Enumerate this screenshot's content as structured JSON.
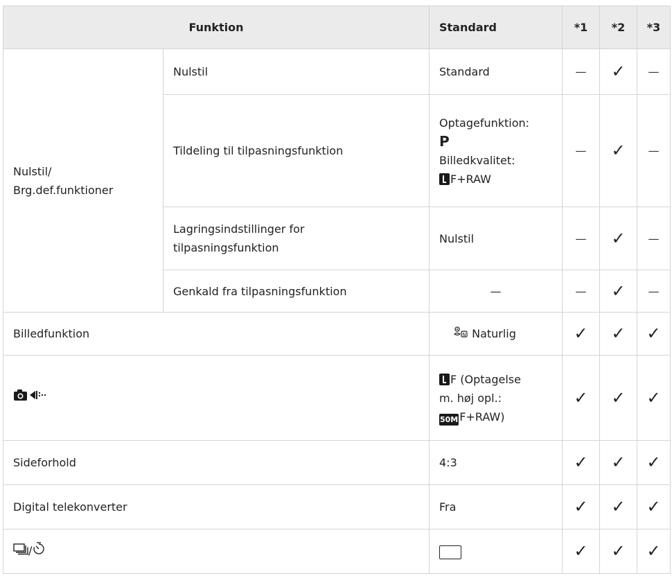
{
  "header": {
    "function": "Funktion",
    "standard": "Standard",
    "col1": "*1",
    "col2": "*2",
    "col3": "*3"
  },
  "symbols": {
    "check": "✓",
    "dash": "—"
  },
  "group": {
    "label_line1": "Nulstil/",
    "label_line2": "Brg.def.funktioner",
    "rows": [
      {
        "name": "Nulstil",
        "standard": "Standard",
        "c1": "—",
        "c2": "✓",
        "c3": "—"
      },
      {
        "name": "Tildeling til tilpasningsfunktion",
        "standard_line1": "Optagefunktion:",
        "standard_mode": "P",
        "standard_line3": "Billedkvalitet:",
        "standard_quality": "F+RAW",
        "standard_quality_icon": "large-fine-icon",
        "c1": "—",
        "c2": "✓",
        "c3": "—"
      },
      {
        "name_line1": "Lagringsindstillinger for",
        "name_line2": "tilpasningsfunktion",
        "standard": "Nulstil",
        "c1": "—",
        "c2": "✓",
        "c3": "—"
      },
      {
        "name": "Genkald fra tilpasningsfunktion",
        "standard": "—",
        "c1": "—",
        "c2": "✓",
        "c3": "—"
      }
    ]
  },
  "rows": [
    {
      "name": "Billedfunktion",
      "standard": "Naturlig",
      "standard_icon": "picture-mode-natural-icon",
      "c1": "✓",
      "c2": "✓",
      "c3": "✓"
    },
    {
      "name_icon": "camera-image-quality-icon",
      "standard_line1_text": "F (Optagelse",
      "standard_line2": "m. høj opl.:",
      "standard_line3_icon_text": "50M",
      "standard_line3_text": "F+RAW)",
      "c1": "✓",
      "c2": "✓",
      "c3": "✓"
    },
    {
      "name": "Sideforhold",
      "standard": "4:3",
      "c1": "✓",
      "c2": "✓",
      "c3": "✓"
    },
    {
      "name": "Digital telekonverter",
      "standard": "Fra",
      "c1": "✓",
      "c2": "✓",
      "c3": "✓"
    },
    {
      "name": "/",
      "name_icons": [
        "sequential-shooting-icon",
        "self-timer-icon"
      ],
      "standard_icon": "single-frame-icon",
      "c1": "✓",
      "c2": "✓",
      "c3": "✓"
    }
  ]
}
